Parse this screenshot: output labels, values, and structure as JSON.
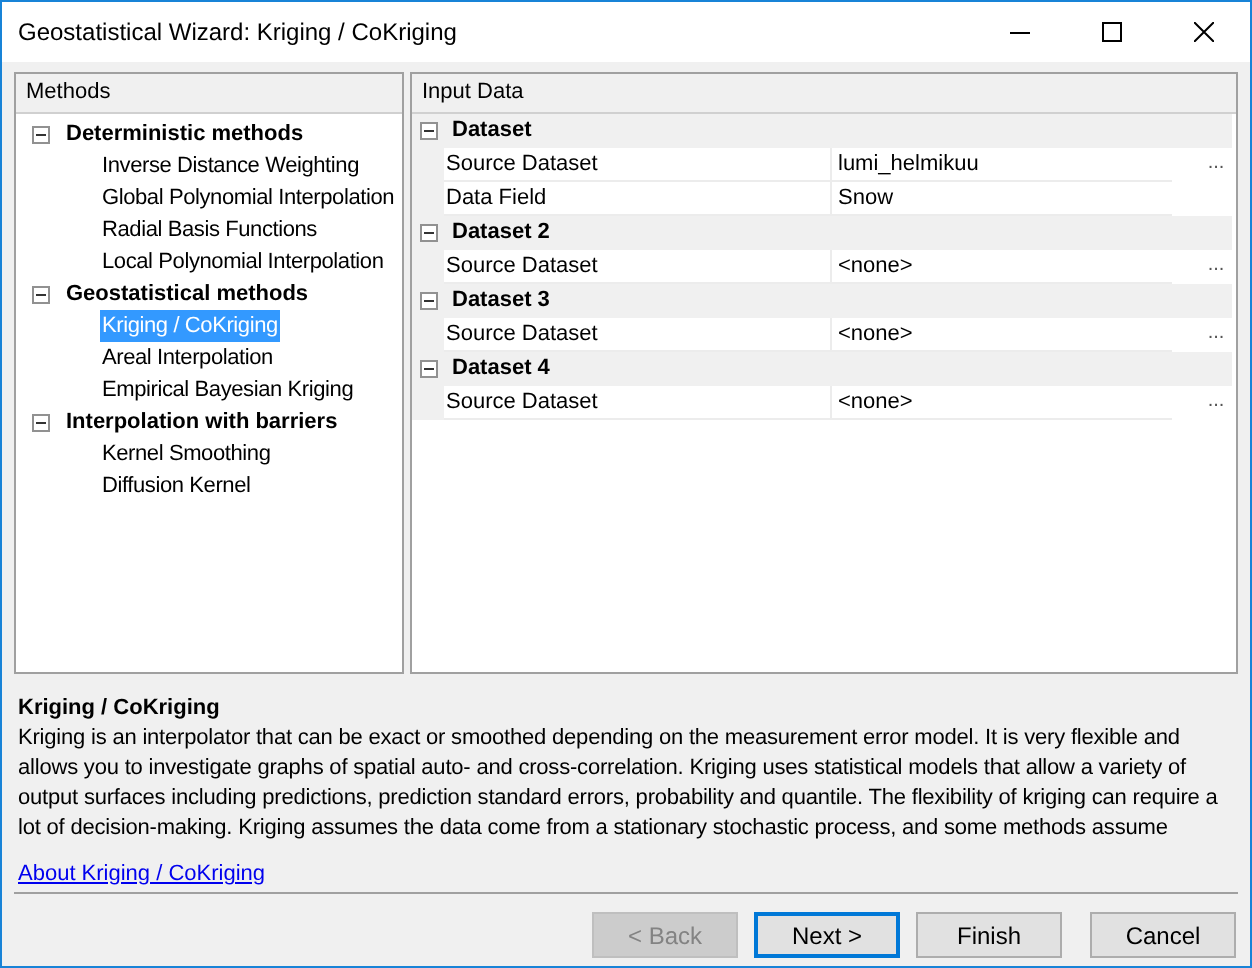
{
  "window": {
    "title": "Geostatistical Wizard: Kriging / CoKriging"
  },
  "methods": {
    "header": "Methods",
    "groups": [
      {
        "label": "Deterministic methods",
        "expanded": true,
        "children": [
          {
            "label": "Inverse Distance Weighting",
            "selected": false
          },
          {
            "label": "Global Polynomial Interpolation",
            "selected": false
          },
          {
            "label": "Radial Basis Functions",
            "selected": false
          },
          {
            "label": "Local Polynomial Interpolation",
            "selected": false
          }
        ]
      },
      {
        "label": "Geostatistical methods",
        "expanded": true,
        "children": [
          {
            "label": "Kriging / CoKriging",
            "selected": true
          },
          {
            "label": "Areal Interpolation",
            "selected": false
          },
          {
            "label": "Empirical Bayesian Kriging",
            "selected": false
          }
        ]
      },
      {
        "label": "Interpolation with barriers",
        "expanded": true,
        "children": [
          {
            "label": "Kernel Smoothing",
            "selected": false
          },
          {
            "label": "Diffusion Kernel",
            "selected": false
          }
        ]
      }
    ]
  },
  "input_data": {
    "header": "Input Data",
    "categories": [
      {
        "label": "Dataset",
        "expanded": true,
        "properties": [
          {
            "name": "Source Dataset",
            "value": "lumi_helmikuu",
            "button": "..."
          },
          {
            "name": "Data Field",
            "value": "Snow"
          }
        ]
      },
      {
        "label": "Dataset 2",
        "expanded": true,
        "properties": [
          {
            "name": "Source Dataset",
            "value": "<none>",
            "button": "..."
          }
        ]
      },
      {
        "label": "Dataset 3",
        "expanded": true,
        "properties": [
          {
            "name": "Source Dataset",
            "value": "<none>",
            "button": "..."
          }
        ]
      },
      {
        "label": "Dataset 4",
        "expanded": true,
        "properties": [
          {
            "name": "Source Dataset",
            "value": "<none>",
            "button": "..."
          }
        ]
      }
    ]
  },
  "description": {
    "title": "Kriging / CoKriging",
    "text": "Kriging is an interpolator that can be exact or smoothed depending on the measurement error model. It is very flexible and allows you to investigate graphs of spatial auto- and cross-correlation. Kriging uses statistical models that allow a variety of output surfaces including predictions, prediction standard errors, probability and quantile. The flexibility of kriging can require a lot of decision-making. Kriging assumes the data come from a stationary stochastic process, and some methods assume",
    "link": "About Kriging / CoKriging"
  },
  "buttons": [
    {
      "label": "< Back",
      "disabled": true,
      "default": false
    },
    {
      "label": "Next >",
      "disabled": false,
      "default": true
    },
    {
      "label": "Finish",
      "disabled": false,
      "default": false
    },
    {
      "label": "Cancel",
      "disabled": false,
      "default": false
    }
  ]
}
